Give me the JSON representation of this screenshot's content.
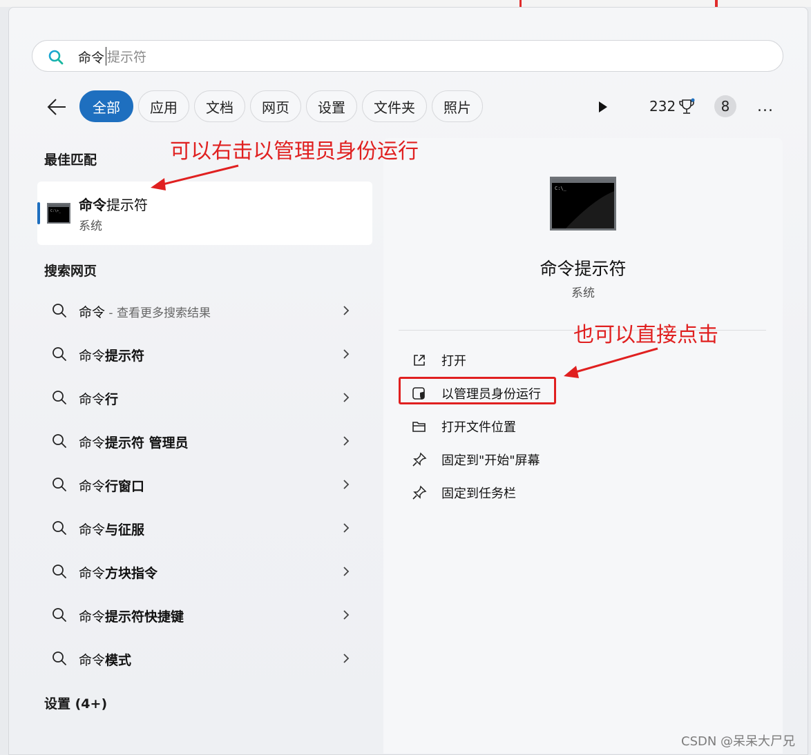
{
  "search": {
    "value": "命令",
    "placeholder": "提示符"
  },
  "filters": [
    "全部",
    "应用",
    "文档",
    "网页",
    "设置",
    "文件夹",
    "照片"
  ],
  "toolbar": {
    "points": "232",
    "badge": "8",
    "more": "..."
  },
  "best_match": {
    "heading": "最佳匹配",
    "title_bold": "命令",
    "title_rest": "提示符",
    "subtitle": "系统"
  },
  "web_search": {
    "heading": "搜索网页",
    "items": [
      {
        "plain": "命令",
        "bold": "",
        "hint": " - 查看更多搜索结果"
      },
      {
        "plain": "命令",
        "bold": "提示符",
        "hint": ""
      },
      {
        "plain": "命令",
        "bold": "行",
        "hint": ""
      },
      {
        "plain": "命令",
        "bold": "提示符 管理员",
        "hint": ""
      },
      {
        "plain": "命令",
        "bold": "行窗口",
        "hint": ""
      },
      {
        "plain": "命令",
        "bold": "与征服",
        "hint": ""
      },
      {
        "plain": "命令",
        "bold": "方块指令",
        "hint": ""
      },
      {
        "plain": "命令",
        "bold": "提示符快捷键",
        "hint": ""
      },
      {
        "plain": "命令",
        "bold": "模式",
        "hint": ""
      }
    ]
  },
  "settings_heading": "设置 (4+)",
  "detail": {
    "title": "命令提示符",
    "subtitle": "系统",
    "actions": [
      "打开",
      "以管理员身份运行",
      "打开文件位置",
      "固定到\"开始\"屏幕",
      "固定到任务栏"
    ]
  },
  "annotations": {
    "right_click": "可以右击以管理员身份运行",
    "direct_click": "也可以直接点击"
  },
  "watermark": "CSDN @呆呆大尸兄",
  "colors": {
    "accent": "#1e6fbf",
    "annotation": "#e02020"
  }
}
